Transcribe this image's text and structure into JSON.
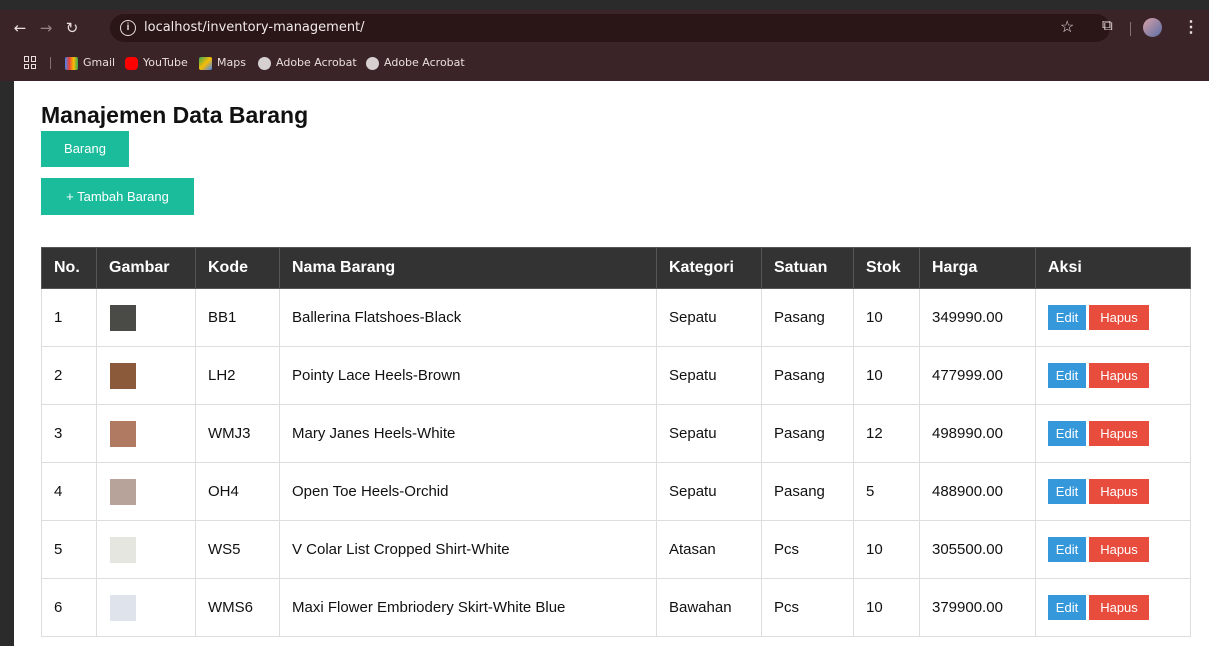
{
  "browser": {
    "url": "localhost/inventory-management/",
    "bookmarks": [
      {
        "label": "Gmail",
        "icon": "gmail-icon"
      },
      {
        "label": "YouTube",
        "icon": "youtube-icon"
      },
      {
        "label": "Maps",
        "icon": "maps-icon"
      },
      {
        "label": "Adobe Acrobat",
        "icon": "acrobat-icon"
      },
      {
        "label": "Adobe Acrobat",
        "icon": "acrobat-icon"
      }
    ]
  },
  "page": {
    "title": "Manajemen Data Barang",
    "nav_label": "Barang",
    "add_label": "+ Tambah Barang"
  },
  "table": {
    "headers": [
      "No.",
      "Gambar",
      "Kode",
      "Nama Barang",
      "Kategori",
      "Satuan",
      "Stok",
      "Harga",
      "Aksi"
    ],
    "edit_label": "Edit",
    "delete_label": "Hapus",
    "rows": [
      {
        "no": "1",
        "kode": "BB1",
        "nama": "Ballerina Flatshoes-Black",
        "kategori": "Sepatu",
        "satuan": "Pasang",
        "stok": "10",
        "harga": "349990.00",
        "thumb_color": "#4a4a46"
      },
      {
        "no": "2",
        "kode": "LH2",
        "nama": "Pointy Lace Heels-Brown",
        "kategori": "Sepatu",
        "satuan": "Pasang",
        "stok": "10",
        "harga": "477999.00",
        "thumb_color": "#8a5a3a"
      },
      {
        "no": "3",
        "kode": "WMJ3",
        "nama": "Mary Janes Heels-White",
        "kategori": "Sepatu",
        "satuan": "Pasang",
        "stok": "12",
        "harga": "498990.00",
        "thumb_color": "#b07a62"
      },
      {
        "no": "4",
        "kode": "OH4",
        "nama": "Open Toe Heels-Orchid",
        "kategori": "Sepatu",
        "satuan": "Pasang",
        "stok": "5",
        "harga": "488900.00",
        "thumb_color": "#b8a39a"
      },
      {
        "no": "5",
        "kode": "WS5",
        "nama": "V Colar List Cropped Shirt-White",
        "kategori": "Atasan",
        "satuan": "Pcs",
        "stok": "10",
        "harga": "305500.00",
        "thumb_color": "#e6e6e0"
      },
      {
        "no": "6",
        "kode": "WMS6",
        "nama": "Maxi Flower Embriodery Skirt-White Blue",
        "kategori": "Bawahan",
        "satuan": "Pcs",
        "stok": "10",
        "harga": "379900.00",
        "thumb_color": "#dfe4ec"
      }
    ]
  },
  "colors": {
    "primary": "#1abc9c",
    "edit": "#3498db",
    "delete": "#e74c3c",
    "header_bg": "#333333"
  }
}
